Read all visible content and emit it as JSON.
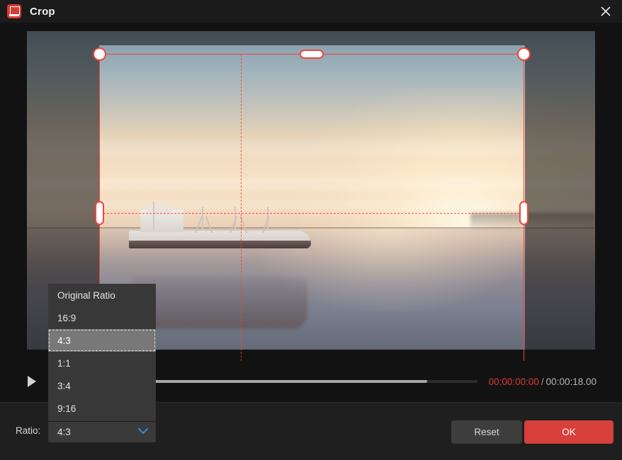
{
  "window": {
    "title": "Crop",
    "app_icon": "app-logo-icon",
    "close_icon": "close-icon"
  },
  "preview": {
    "scene_description": "cargo-ship-at-sunset",
    "crop_handles": [
      "top-left",
      "top-center",
      "top-right",
      "middle-left",
      "middle-right",
      "bottom-left",
      "bottom-center",
      "bottom-right"
    ],
    "guide_color": "#f4433c"
  },
  "timeline": {
    "play_icon": "play-icon",
    "progress_percent": 88,
    "current_time": "00:00:00:00",
    "separator": "/",
    "total_time": "00:00:18.00",
    "current_time_color": "#e03c31"
  },
  "bottom": {
    "ratio_label": "Ratio:",
    "ratio_value": "4:3",
    "chevron_icon": "chevron-down-icon",
    "chevron_color": "#2f86e0",
    "reset_label": "Reset",
    "ok_label": "OK",
    "ok_color": "#d8403c"
  },
  "ratio_dropdown": {
    "open": true,
    "selected": "4:3",
    "options": [
      {
        "label": "Original Ratio"
      },
      {
        "label": "16:9"
      },
      {
        "label": "4:3"
      },
      {
        "label": "1:1"
      },
      {
        "label": "3:4"
      },
      {
        "label": "9:16"
      }
    ]
  }
}
